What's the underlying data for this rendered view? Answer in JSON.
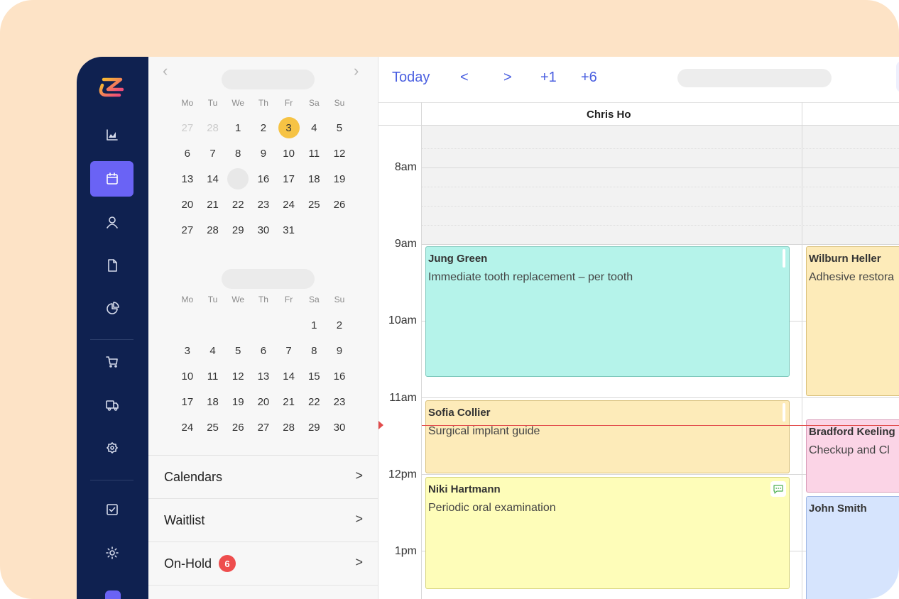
{
  "colors": {
    "background": "#fde3c6",
    "sidebar": "#0f2150",
    "accent": "#6a63f5",
    "today_highlight": "#f6c344",
    "link": "#4a5fe0",
    "now_line": "#e24c4c"
  },
  "sidebar": {
    "logo": "zenoti-logo",
    "items": [
      {
        "icon": "chart-icon"
      },
      {
        "icon": "calendar-icon",
        "active": true
      },
      {
        "icon": "user-icon"
      },
      {
        "icon": "document-icon"
      },
      {
        "icon": "pie-chart-icon"
      },
      {
        "icon": "cart-icon"
      },
      {
        "icon": "truck-icon"
      },
      {
        "icon": "badge-gear-icon"
      },
      {
        "icon": "checkbox-icon"
      },
      {
        "icon": "settings-icon"
      }
    ]
  },
  "mini_calendar": {
    "prev_icon": "chevron-left-icon",
    "next_icon": "chevron-right-icon",
    "weekdays": [
      "Mo",
      "Tu",
      "We",
      "Th",
      "Fr",
      "Sa",
      "Su"
    ],
    "month1": {
      "weeks": [
        [
          "27",
          "28",
          "1",
          "2",
          "3",
          "4",
          "5"
        ],
        [
          "6",
          "7",
          "8",
          "9",
          "10",
          "11",
          "12"
        ],
        [
          "13",
          "14",
          "",
          "16",
          "17",
          "18",
          "19"
        ],
        [
          "20",
          "21",
          "22",
          "23",
          "24",
          "25",
          "26"
        ],
        [
          "27",
          "28",
          "29",
          "30",
          "31",
          "",
          ""
        ]
      ]
    },
    "month2": {
      "weeks": [
        [
          "",
          "",
          "",
          "",
          "",
          "1",
          "2"
        ],
        [
          "3",
          "4",
          "5",
          "6",
          "7",
          "8",
          "9"
        ],
        [
          "10",
          "11",
          "12",
          "13",
          "14",
          "15",
          "16"
        ],
        [
          "17",
          "18",
          "19",
          "20",
          "21",
          "22",
          "23"
        ],
        [
          "24",
          "25",
          "26",
          "27",
          "28",
          "29",
          "30"
        ]
      ]
    }
  },
  "panel_menu": {
    "calendars": "Calendars",
    "waitlist": "Waitlist",
    "on_hold": "On-Hold",
    "on_hold_count": "6",
    "arrow": ">"
  },
  "toolbar": {
    "today": "Today",
    "prev": "<",
    "next": ">",
    "plus1": "+1",
    "plus6": "+6"
  },
  "schedule": {
    "columns": [
      {
        "name": "Chris Ho"
      },
      {
        "name": ""
      }
    ],
    "times": [
      "8am",
      "9am",
      "10am",
      "11am",
      "12pm",
      "1pm"
    ],
    "appointments": [
      {
        "client": "Jung Green",
        "service": "Immediate tooth replacement – per tooth",
        "color": "#b5f3ea",
        "border": "#7fc9bd"
      },
      {
        "client": "Sofia Collier",
        "service": "Surgical implant guide",
        "color": "#fdebb9",
        "border": "#d9c07a"
      },
      {
        "client": "Niki Hartmann",
        "service": "Periodic oral examination",
        "color": "#fefdb9",
        "border": "#d6d37c"
      },
      {
        "client": "Wilburn Heller",
        "service": "Adhesive restora",
        "color": "#fdebb9",
        "border": "#d9c07a"
      },
      {
        "client": "Bradford Keeling",
        "service": "Checkup and Cl",
        "color": "#fbd4e6",
        "border": "#d89cb8"
      },
      {
        "client": "John Smith",
        "service": "",
        "color": "#d6e4fd",
        "border": "#9fb7e4"
      }
    ]
  }
}
